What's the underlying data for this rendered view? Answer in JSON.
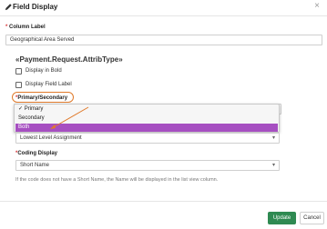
{
  "header": {
    "title": "Field Display",
    "close_symbol": "×"
  },
  "column_label": {
    "required_mark": "*",
    "label": "Column Label",
    "value": "Geographical Area Served"
  },
  "section": {
    "title": "«Payment.Request.AttribType»"
  },
  "checkboxes": [
    {
      "label": "Display in Bold",
      "checked": false
    },
    {
      "label": "Display Field Label",
      "checked": false
    }
  ],
  "primary_secondary": {
    "required_mark": "*",
    "label": "Primary/Secondary",
    "options": [
      {
        "label": "✓ Primary",
        "state": "checked"
      },
      {
        "label": "Secondary",
        "state": "normal"
      },
      {
        "label": "Both",
        "state": "hover"
      }
    ]
  },
  "level_select": {
    "value": "Lowest Level Assignment"
  },
  "coding_display": {
    "required_mark": "*",
    "label": "Coding Display",
    "value": "Short Name"
  },
  "help_text": "If the code does not have a Short Name, the Name will be displayed in the list view column.",
  "buttons": {
    "update": "Update",
    "cancel": "Cancel"
  },
  "colors": {
    "accent_hover": "#a64fc1",
    "primary_button": "#2f8a52",
    "annotation": "#e07a2b",
    "required": "#d9383a"
  }
}
